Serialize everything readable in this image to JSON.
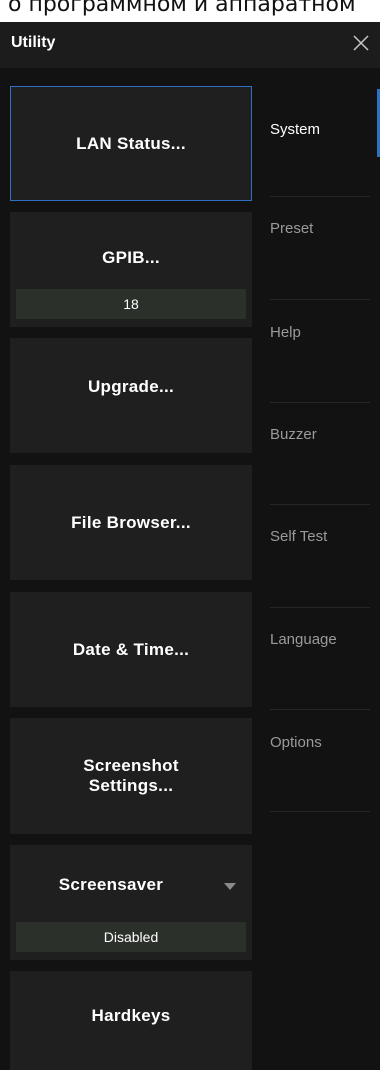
{
  "header_partial_text": "о программном и аппаратном",
  "title": "Utility",
  "keys": [
    {
      "label": "LAN Status..."
    },
    {
      "label": "GPIB...",
      "value": "18"
    },
    {
      "label": "Upgrade..."
    },
    {
      "label": "File Browser..."
    },
    {
      "label": "Date & Time..."
    },
    {
      "label": "Screenshot\nSettings..."
    },
    {
      "label": "Screensaver",
      "value": "Disabled"
    },
    {
      "label": "Hardkeys"
    }
  ],
  "tabs": [
    "System",
    "Preset",
    "Help",
    "Buzzer",
    "Self Test",
    "Language",
    "Options"
  ],
  "active_tab": "System",
  "colors": {
    "accent": "#2f6fc4",
    "panel": "#121212",
    "key": "#1f1f1f",
    "value_box": "#2b302b"
  }
}
